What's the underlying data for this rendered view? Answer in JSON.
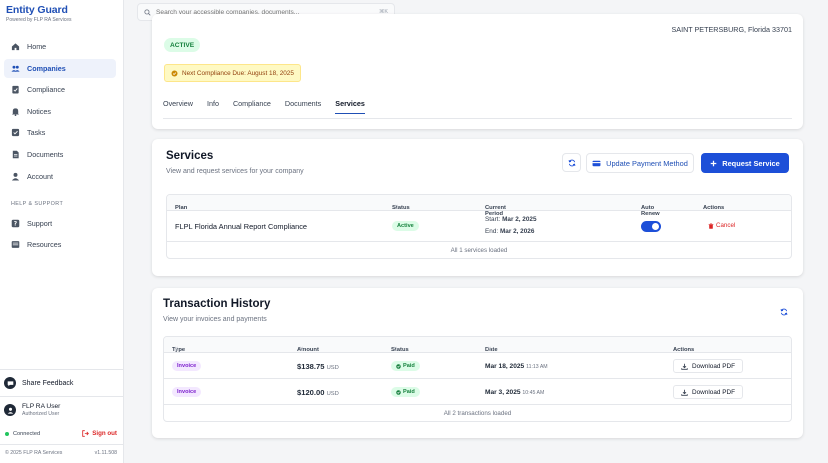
{
  "sidebar": {
    "brand_title": "Entity Guard",
    "brand_sub": "Powered by FLP RA Services",
    "items": [
      {
        "label": "Home",
        "icon": "home-icon"
      },
      {
        "label": "Companies",
        "icon": "users-icon",
        "active": true
      },
      {
        "label": "Compliance",
        "icon": "clipboard-check-icon"
      },
      {
        "label": "Notices",
        "icon": "bell-icon"
      },
      {
        "label": "Tasks",
        "icon": "checkbox-icon"
      },
      {
        "label": "Documents",
        "icon": "document-icon"
      },
      {
        "label": "Account",
        "icon": "account-icon"
      }
    ],
    "section_label": "HELP & SUPPORT",
    "support_items": [
      {
        "label": "Support",
        "icon": "help-icon"
      },
      {
        "label": "Resources",
        "icon": "resources-icon"
      }
    ],
    "feedback_label": "Share Feedback",
    "user_name": "FLP RA User",
    "user_role": "Authorized User",
    "connection_status": "Connected",
    "sign_out_label": "Sign out",
    "copyright": "© 2025 FLP RA Services",
    "version": "v1.11.508"
  },
  "search": {
    "placeholder": "Search your accessible companies, documents...",
    "shortcut": "⌘K"
  },
  "company": {
    "address": "SAINT PETERSBURG, Florida 33701",
    "status_badge": "ACTIVE",
    "compliance_due": "Next Compliance Due: August 18, 2025",
    "tabs": [
      "Overview",
      "Info",
      "Compliance",
      "Documents",
      "Services"
    ],
    "active_tab": "Services"
  },
  "services": {
    "title": "Services",
    "subtitle": "View and request services for your company",
    "update_payment_label": "Update Payment Method",
    "request_service_label": "Request Service",
    "columns": [
      "Plan",
      "Status",
      "Current Period",
      "Auto Renew",
      "Actions"
    ],
    "rows": [
      {
        "plan": "FLPL Florida Annual Report Compliance",
        "status": "Active",
        "start_label": "Start:",
        "start_date": "Mar 2, 2025",
        "end_label": "End:",
        "end_date": "Mar 2, 2026",
        "auto_renew": true,
        "action": "Cancel"
      }
    ],
    "footer": "All 1 services loaded"
  },
  "transactions": {
    "title": "Transaction History",
    "subtitle": "View your invoices and payments",
    "columns": [
      "Type",
      "Amount",
      "Status",
      "Date",
      "Actions"
    ],
    "rows": [
      {
        "type": "Invoice",
        "amount": "$138.75",
        "currency": "USD",
        "status": "Paid",
        "date": "Mar 18, 2025",
        "time": "11:13 AM",
        "action": "Download PDF"
      },
      {
        "type": "Invoice",
        "amount": "$120.00",
        "currency": "USD",
        "status": "Paid",
        "date": "Mar 3, 2025",
        "time": "10:45 AM",
        "action": "Download PDF"
      }
    ],
    "footer": "All 2 transactions loaded"
  },
  "colors": {
    "brand": "#1f4fb5",
    "primary_button": "#1d4fd8",
    "active_green": "#15803d",
    "danger": "#dc2626",
    "invoice_purple": "#7e22ce"
  }
}
